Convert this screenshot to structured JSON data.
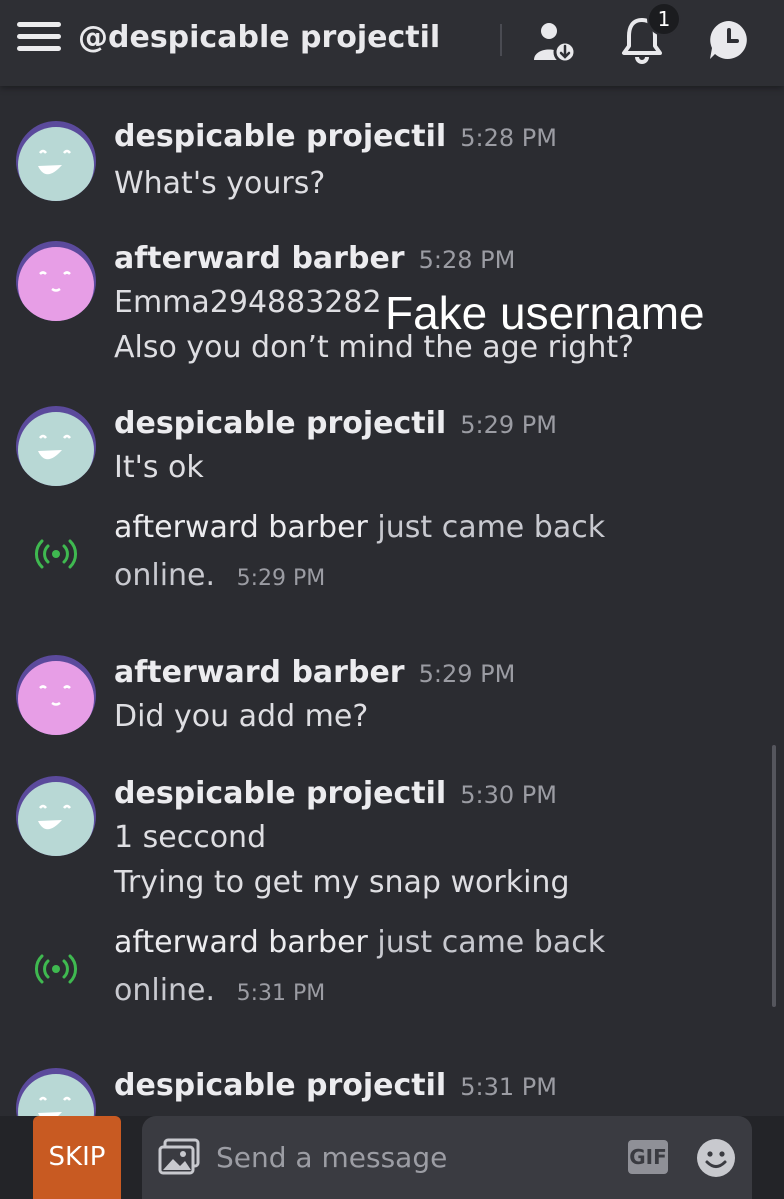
{
  "header": {
    "title": "@despicable projectil",
    "notification_count": "1",
    "icons": [
      "menu-icon",
      "add-friend-icon",
      "bell-icon",
      "history-icon"
    ]
  },
  "messages": [
    {
      "type": "user",
      "author": "despicable projectil",
      "time": "5:28 PM",
      "lines": [
        "What's yours?"
      ],
      "avatar_color": "#b8d8d5"
    },
    {
      "type": "user",
      "author": "afterward barber",
      "time": "5:28 PM",
      "lines": [
        "Emma294883282",
        "Also you don’t mind the age right?"
      ],
      "avatar_color": "#e79ee6"
    },
    {
      "type": "user",
      "author": "despicable projectil",
      "time": "5:29 PM",
      "lines": [
        "It's ok"
      ],
      "avatar_color": "#b8d8d5"
    },
    {
      "type": "system",
      "who": "afterward barber",
      "text": "just came back online.",
      "time": "5:29 PM"
    },
    {
      "type": "user",
      "author": "afterward barber",
      "time": "5:29 PM",
      "lines": [
        "Did you add me?"
      ],
      "avatar_color": "#e79ee6"
    },
    {
      "type": "user",
      "author": "despicable projectil",
      "time": "5:30 PM",
      "lines": [
        "1 seccond",
        "Trying to get my snap working"
      ],
      "avatar_color": "#b8d8d5"
    },
    {
      "type": "system",
      "who": "afterward barber",
      "text": "just came back online.",
      "time": "5:31 PM"
    },
    {
      "type": "user",
      "author": "despicable projectil",
      "time": "5:31 PM",
      "lines": [],
      "avatar_color": "#b8d8d5"
    }
  ],
  "overlay_annotation": "Fake username",
  "composer": {
    "skip_label": "SKIP",
    "placeholder": "Send a message",
    "gif_label": "GIF"
  },
  "colors": {
    "background": "#2b2c31",
    "skip": "#c85a22",
    "online_icon": "#3fb950",
    "avatar_ring": "#5b4a9c"
  }
}
